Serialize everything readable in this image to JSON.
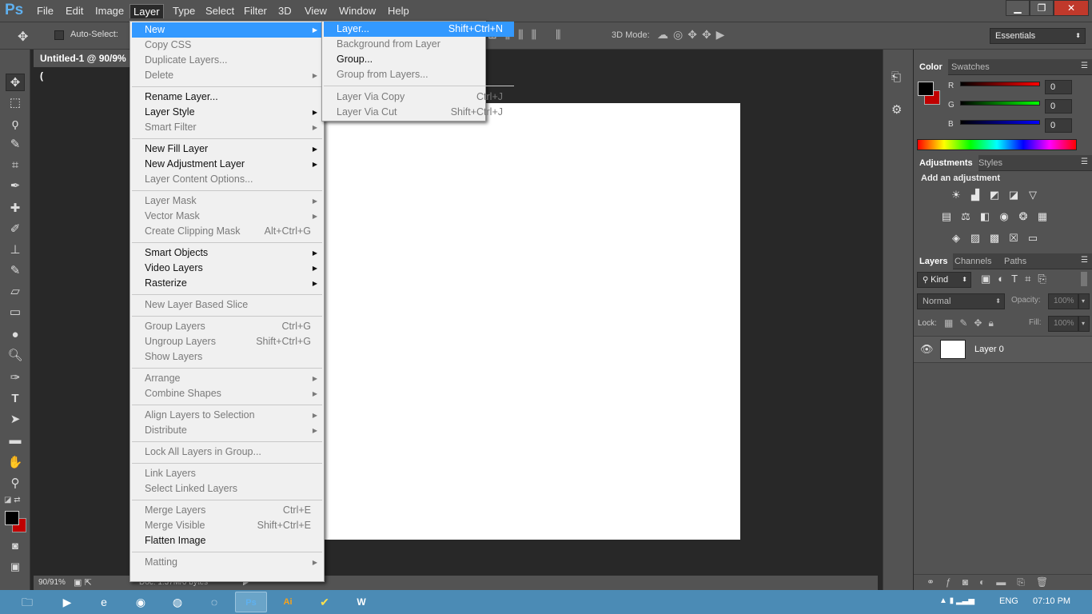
{
  "app": {
    "logo": "Ps"
  },
  "menubar": {
    "items": [
      "File",
      "Edit",
      "Image",
      "Layer",
      "Type",
      "Select",
      "Filter",
      "3D",
      "View",
      "Window",
      "Help"
    ],
    "active": "Layer"
  },
  "window_controls": {
    "minimize": "▁",
    "restore": "❐",
    "close": "✕"
  },
  "options_bar": {
    "auto_select_label": "Auto-Select:",
    "mode_3d_label": "3D Mode:",
    "workspace": "Essentials"
  },
  "document": {
    "tab_title": "Untitled-1 @ 90/9% (",
    "zoom": "90/91%",
    "doc_info": "Doc: 1.37M/0 bytes"
  },
  "layer_menu": {
    "items": [
      {
        "label": "New",
        "shortcut": "",
        "arrow": true,
        "disabled": false,
        "highlighted": true
      },
      {
        "label": "Copy CSS",
        "shortcut": "",
        "arrow": false,
        "disabled": true
      },
      {
        "label": "Duplicate Layers...",
        "shortcut": "",
        "arrow": false,
        "disabled": true
      },
      {
        "label": "Delete",
        "shortcut": "",
        "arrow": true,
        "disabled": true
      },
      {
        "sep": true
      },
      {
        "label": "Rename Layer...",
        "shortcut": "",
        "arrow": false,
        "disabled": false
      },
      {
        "label": "Layer Style",
        "shortcut": "",
        "arrow": true,
        "disabled": false
      },
      {
        "label": "Smart Filter",
        "shortcut": "",
        "arrow": true,
        "disabled": true
      },
      {
        "sep": true
      },
      {
        "label": "New Fill Layer",
        "shortcut": "",
        "arrow": true,
        "disabled": false
      },
      {
        "label": "New Adjustment Layer",
        "shortcut": "",
        "arrow": true,
        "disabled": false
      },
      {
        "label": "Layer Content Options...",
        "shortcut": "",
        "arrow": false,
        "disabled": true
      },
      {
        "sep": true
      },
      {
        "label": "Layer Mask",
        "shortcut": "",
        "arrow": true,
        "disabled": true
      },
      {
        "label": "Vector Mask",
        "shortcut": "",
        "arrow": true,
        "disabled": true
      },
      {
        "label": "Create Clipping Mask",
        "shortcut": "Alt+Ctrl+G",
        "arrow": false,
        "disabled": true
      },
      {
        "sep": true
      },
      {
        "label": "Smart Objects",
        "shortcut": "",
        "arrow": true,
        "disabled": false
      },
      {
        "label": "Video Layers",
        "shortcut": "",
        "arrow": true,
        "disabled": false
      },
      {
        "label": "Rasterize",
        "shortcut": "",
        "arrow": true,
        "disabled": false
      },
      {
        "sep": true
      },
      {
        "label": "New Layer Based Slice",
        "shortcut": "",
        "arrow": false,
        "disabled": true
      },
      {
        "sep": true
      },
      {
        "label": "Group Layers",
        "shortcut": "Ctrl+G",
        "arrow": false,
        "disabled": true
      },
      {
        "label": "Ungroup Layers",
        "shortcut": "Shift+Ctrl+G",
        "arrow": false,
        "disabled": true
      },
      {
        "label": "Show Layers",
        "shortcut": "",
        "arrow": false,
        "disabled": true
      },
      {
        "sep": true
      },
      {
        "label": "Arrange",
        "shortcut": "",
        "arrow": true,
        "disabled": true
      },
      {
        "label": "Combine Shapes",
        "shortcut": "",
        "arrow": true,
        "disabled": true
      },
      {
        "sep": true
      },
      {
        "label": "Align Layers to Selection",
        "shortcut": "",
        "arrow": true,
        "disabled": true
      },
      {
        "label": "Distribute",
        "shortcut": "",
        "arrow": true,
        "disabled": true
      },
      {
        "sep": true
      },
      {
        "label": "Lock All Layers in Group...",
        "shortcut": "",
        "arrow": false,
        "disabled": true
      },
      {
        "sep": true
      },
      {
        "label": "Link Layers",
        "shortcut": "",
        "arrow": false,
        "disabled": true
      },
      {
        "label": "Select Linked Layers",
        "shortcut": "",
        "arrow": false,
        "disabled": true
      },
      {
        "sep": true
      },
      {
        "label": "Merge Layers",
        "shortcut": "Ctrl+E",
        "arrow": false,
        "disabled": true
      },
      {
        "label": "Merge Visible",
        "shortcut": "Shift+Ctrl+E",
        "arrow": false,
        "disabled": true
      },
      {
        "label": "Flatten Image",
        "shortcut": "",
        "arrow": false,
        "disabled": false
      },
      {
        "sep": true
      },
      {
        "label": "Matting",
        "shortcut": "",
        "arrow": true,
        "disabled": true
      }
    ]
  },
  "new_submenu": {
    "items": [
      {
        "label": "Layer...",
        "shortcut": "Shift+Ctrl+N",
        "disabled": false,
        "highlighted": true
      },
      {
        "label": "Background from Layer",
        "shortcut": "",
        "disabled": true
      },
      {
        "label": "Group...",
        "shortcut": "",
        "disabled": false
      },
      {
        "label": "Group from Layers...",
        "shortcut": "",
        "disabled": true
      },
      {
        "sep": true
      },
      {
        "label": "Layer Via Copy",
        "shortcut": "Ctrl+J",
        "disabled": true
      },
      {
        "label": "Layer Via Cut",
        "shortcut": "Shift+Ctrl+J",
        "disabled": true
      }
    ]
  },
  "color_panel": {
    "tabs": [
      "Color",
      "Swatches"
    ],
    "channels": [
      {
        "label": "R",
        "value": "0"
      },
      {
        "label": "G",
        "value": "0"
      },
      {
        "label": "B",
        "value": "0"
      }
    ]
  },
  "adjustments_panel": {
    "tabs": [
      "Adjustments",
      "Styles"
    ],
    "heading": "Add an adjustment"
  },
  "layers_panel": {
    "tabs": [
      "Layers",
      "Channels",
      "Paths"
    ],
    "kind_label": "Kind",
    "blend_mode": "Normal",
    "opacity_label": "Opacity:",
    "opacity_value": "100%",
    "lock_label": "Lock:",
    "fill_label": "Fill:",
    "fill_value": "100%",
    "layers": [
      {
        "name": "Layer 0"
      }
    ]
  },
  "taskbar": {
    "language": "ENG",
    "time": "07:10 PM"
  },
  "colors": {
    "accent": "#3399ff",
    "panel": "#535353",
    "canvas_bg": "#282828"
  }
}
